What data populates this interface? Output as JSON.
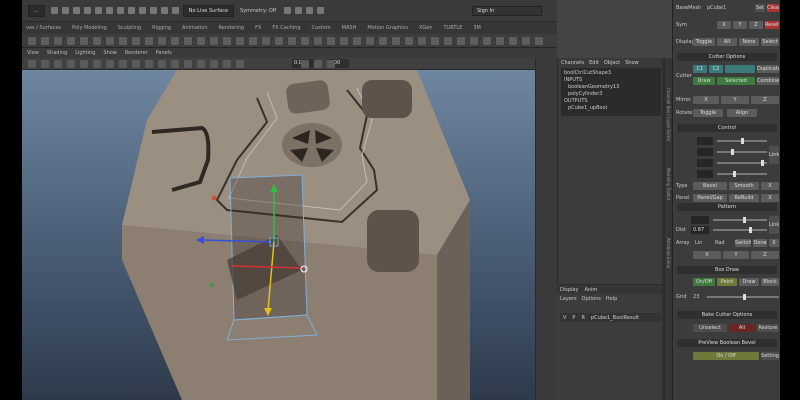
{
  "statusline": {
    "workspace": "...",
    "surface_dropdown": "No Live Surface",
    "symmetry": "Symmetry: Off",
    "sign_in": "Sign In"
  },
  "shelf": {
    "tabs": [
      "ves / Surfaces",
      "Poly Modeling",
      "Sculpting",
      "Rigging",
      "Animation",
      "Rendering",
      "FX",
      "FX Caching",
      "Custom",
      "MASH",
      "Motion Graphics",
      "XGen",
      "TURTLE",
      "3M"
    ]
  },
  "panel_menu": [
    "View",
    "Shading",
    "Lighting",
    "Show",
    "Renderer",
    "Panels"
  ],
  "view_toolbar": {
    "value1": "0.00",
    "value2": "1.00"
  },
  "outliner": {
    "menu": [
      "Channels",
      "Edit",
      "Object",
      "Show"
    ],
    "items": [
      "boolCtrlCutShape3",
      "INPUTS",
      "booleanGeometry13",
      "polyCylinder3",
      "OUTPUTS",
      "pCube1_upBool"
    ]
  },
  "layers": {
    "tabs": [
      "Display",
      "Anim"
    ],
    "menu": [
      "Layers",
      "Options",
      "Help"
    ],
    "row": {
      "v": "V",
      "p": "P",
      "r": "R",
      "name": "pCube1_BoolResult"
    }
  },
  "side_tabs": {
    "strip1": "Channel Box / Layer Editor",
    "strip2": "Modeling Toolkit",
    "strip3": "Attribute Editor"
  },
  "bc": {
    "basemesh_label": "BaseMesh",
    "basemesh_value": "pCube1",
    "set": "Set",
    "clear": "Clear",
    "sym_label": "Sym",
    "sym_x": "X",
    "sym_y": "Y",
    "sym_z": "Z",
    "sym_reset": "Reset",
    "display_label": "Display",
    "display_toggle": "Toggle",
    "display_all": "All",
    "display_none": "None",
    "display_select": "Select",
    "cutter_options_header": "Cutter Options",
    "cutter_label": "Cutter",
    "cutter_btn1": "C1",
    "cutter_btn2": "C2",
    "cutter_draw": "Draw",
    "cutter_selected": "Selected",
    "duplicate": "Duplicate",
    "combine": "Combine",
    "mirror_label": "Mirror",
    "mirror_x": "X",
    "mirror_y": "Y",
    "mirror_z": "Z",
    "rotate_label": "Rotate",
    "rotate_toggle": "Toggle",
    "rotate_align": "Align",
    "control_header": "Control",
    "link": "Link",
    "type_label": "Type",
    "type_bevel": "Bevel",
    "type_smooth": "Smooth",
    "type_x": "X",
    "panel_label": "Panel",
    "panel_gap": "Panel/Gap",
    "rebuild": "ReBuild",
    "panel_x": "X",
    "pattern_header": "Pattern",
    "pattern_link": "Link",
    "dist_label": "Dist",
    "dist_value": "0.87",
    "array_label": "Array",
    "array_lin": "Lin",
    "array_rad": "Rad",
    "array_switch": "Switch",
    "array_done": "Done",
    "array_x": "X",
    "axis_x": "X",
    "axis_y": "Y",
    "axis_z": "Z",
    "box_draw_header": "Box Draw",
    "onoff": "On/Off",
    "point": "Point",
    "draw": "Draw",
    "block": "Block",
    "grid_label": "Grid",
    "grid_value": "23",
    "bake_header": "Bake Cutter Options",
    "unselect": "Unselect",
    "all": "All",
    "restore": "Restore",
    "preview_header": "PreView Boolean Bevel",
    "preview_onoff": "On / Off",
    "setting": "Setting"
  }
}
